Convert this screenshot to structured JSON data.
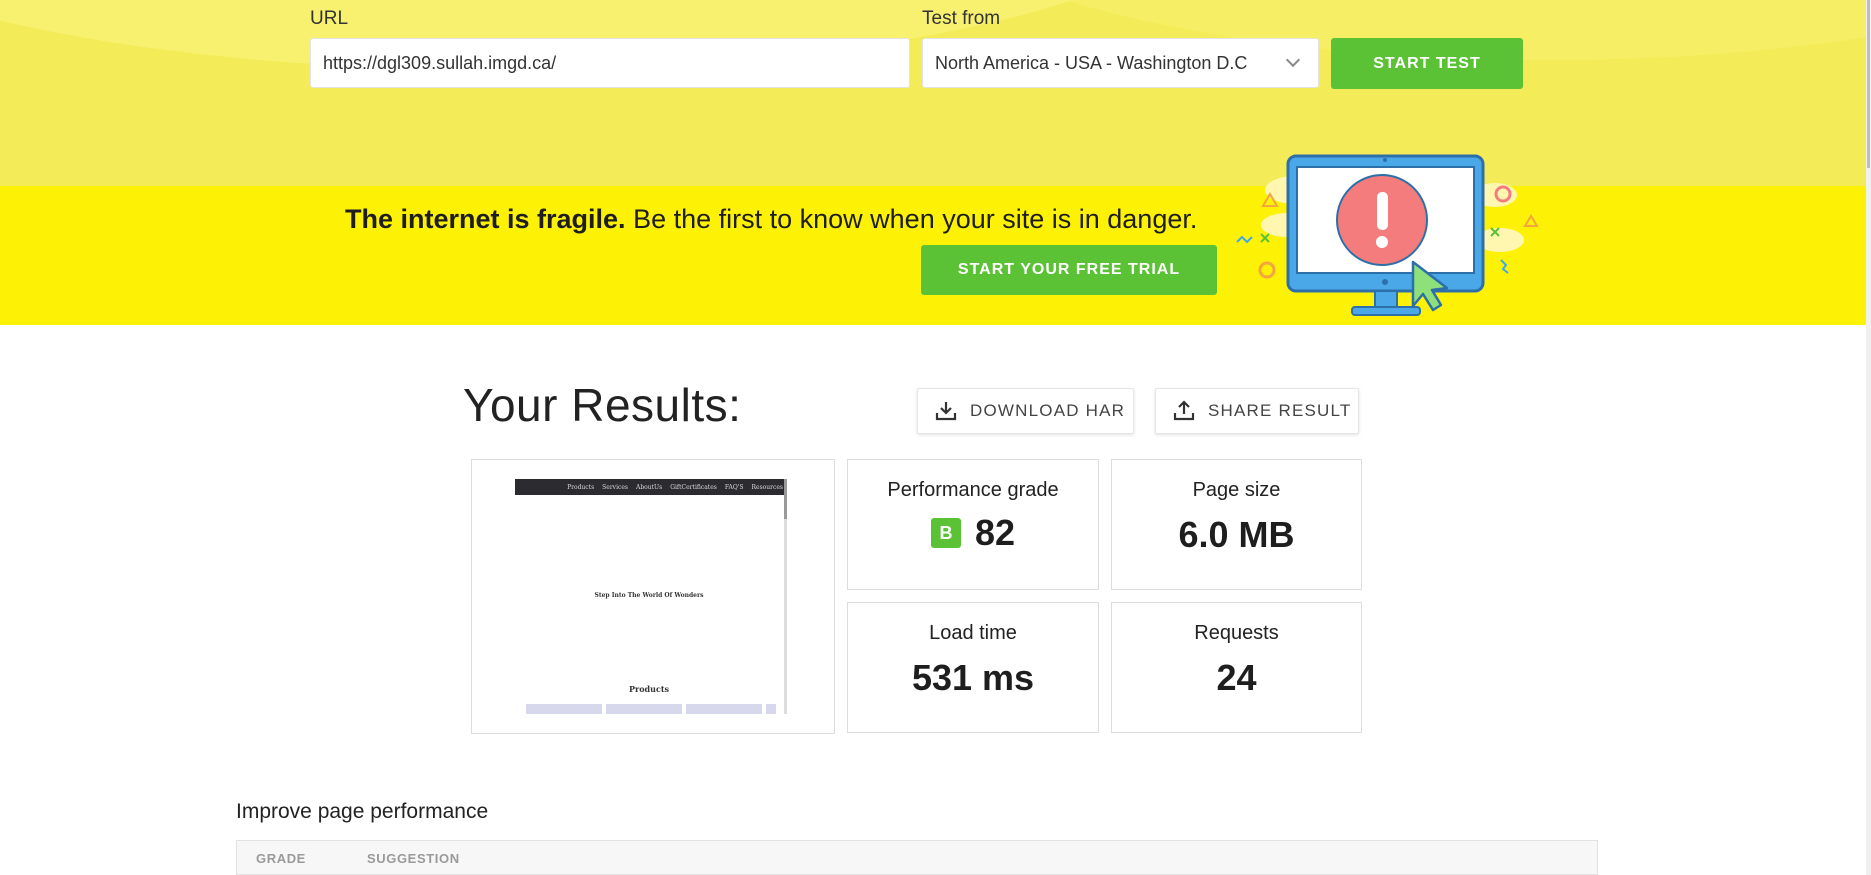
{
  "form": {
    "url_label": "URL",
    "url_value": "https://dgl309.sullah.imgd.ca/",
    "test_from_label": "Test from",
    "test_from_value": "North America - USA - Washington D.C",
    "start_button": "START TEST"
  },
  "banner": {
    "headline_bold": "The internet is fragile.",
    "headline_rest": " Be the first to know when your site is in danger.",
    "trial_button": "START YOUR FREE TRIAL"
  },
  "results": {
    "title": "Your Results:",
    "download_button": "DOWNLOAD HAR",
    "share_button": "SHARE RESULT",
    "performance": {
      "label": "Performance grade",
      "grade": "B",
      "score": "82"
    },
    "page_size": {
      "label": "Page size",
      "value": "6.0 MB"
    },
    "load_time": {
      "label": "Load time",
      "value": "531 ms"
    },
    "requests": {
      "label": "Requests",
      "value": "24"
    }
  },
  "thumbnail": {
    "nav_items": [
      "Products",
      "Services",
      "AboutUs",
      "GiftCertificates",
      "FAQ'S",
      "Resources"
    ],
    "hero_text": "Step Into The World Of Wonders",
    "section_title": "Products"
  },
  "improve": {
    "title": "Improve page performance",
    "columns": {
      "grade": "GRADE",
      "suggestion": "SUGGESTION"
    }
  },
  "colors": {
    "accent_green": "#5bc236",
    "banner_yellow": "#fdf106",
    "form_yellow": "#f3ec58"
  },
  "icons": {
    "download": "download-icon",
    "share": "share-icon",
    "select_chevron": "chevron-down-icon"
  }
}
